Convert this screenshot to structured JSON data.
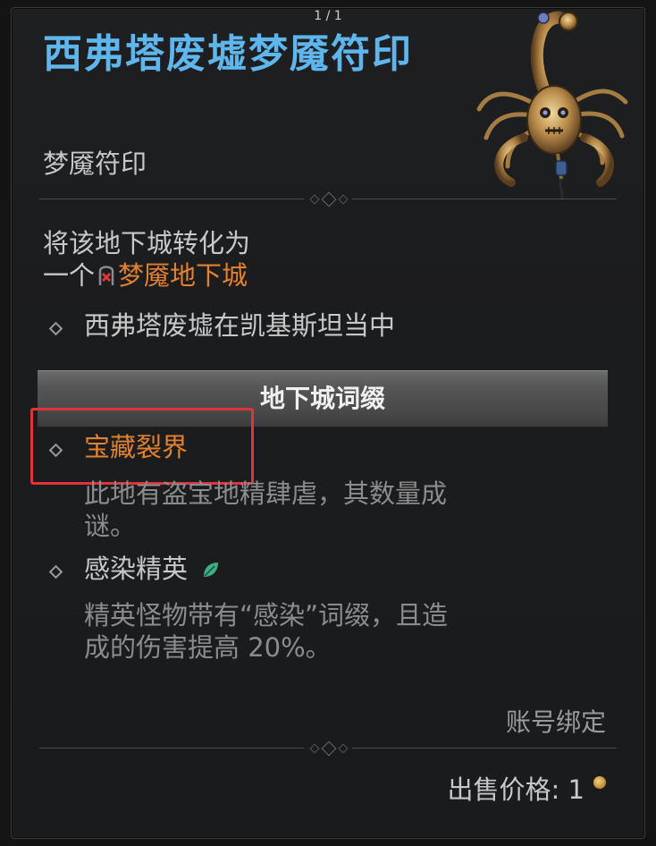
{
  "page_counter": "1 / 1",
  "item": {
    "title": "西弗塔废墟梦魇符印",
    "type": "梦魇符印",
    "description_line1": "将该地下城转化为",
    "description_line2_prefix": "一个",
    "description_line2_link": "梦魇地下城",
    "location": "西弗塔废墟在凯基斯坦当中",
    "affix_header": "地下城词缀",
    "affixes": [
      {
        "name": "宝藏裂界",
        "description_line1": "此地有盗宝地精肆虐，其数量成",
        "description_line2": "谜。",
        "highlighted": true
      },
      {
        "name": "感染精英",
        "description_line1": "精英怪物带有“感染”词缀，且造",
        "description_line2": "成的伤害提高 20%。",
        "icon": "leaf-icon"
      }
    ],
    "binding": "账号绑定",
    "sell_label": "出售价格:",
    "sell_value": "1"
  },
  "colors": {
    "title": "#5fb6ec",
    "orange": "#e2812f",
    "highlight_border": "#e0343c",
    "leaf": "#3fae82"
  }
}
